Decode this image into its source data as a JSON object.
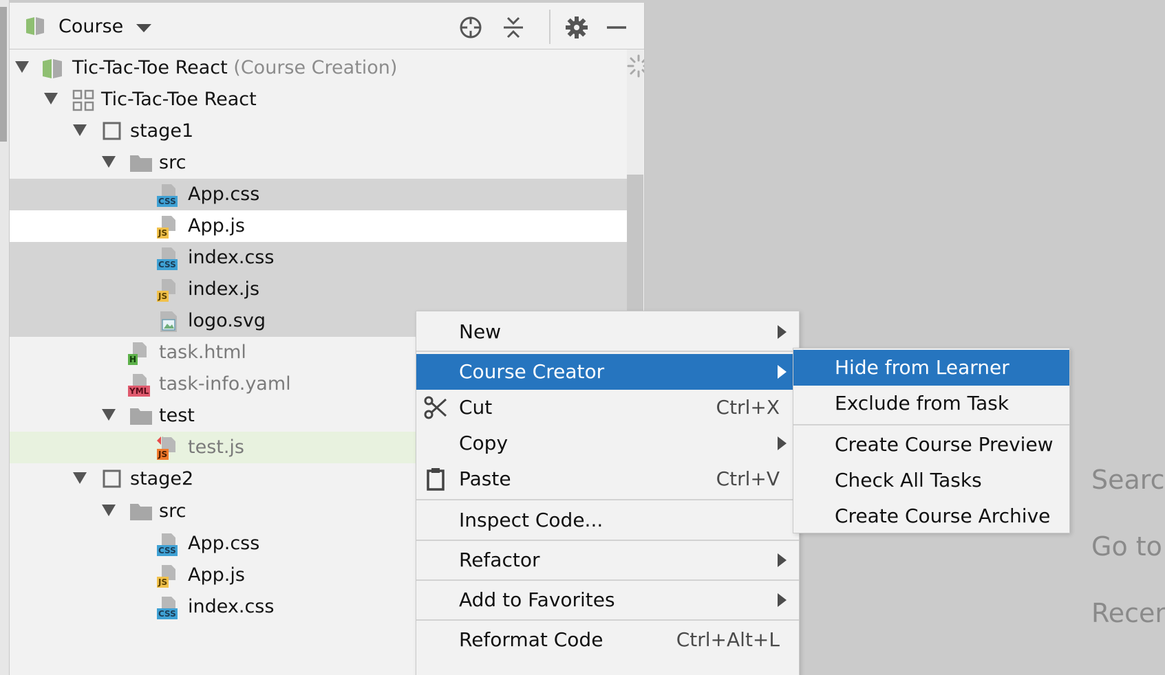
{
  "panel": {
    "view_title": "Course",
    "toolbar_icons": [
      "locate-icon",
      "collapse-all-icon",
      "gear-icon",
      "minimize-icon"
    ]
  },
  "tree": [
    {
      "label": "Tic-Tac-Toe React",
      "suffix": "(Course Creation)",
      "icon": "course-book-icon",
      "expanded": true
    },
    {
      "label": "Tic-Tac-Toe React",
      "icon": "lesson-grid-icon",
      "expanded": true
    },
    {
      "label": "stage1",
      "icon": "task-square-icon",
      "expanded": true
    },
    {
      "label": "src",
      "icon": "folder-icon",
      "expanded": true
    },
    {
      "label": "App.css",
      "icon": "css-file-icon",
      "badge": "CSS",
      "state": "selected"
    },
    {
      "label": "App.js",
      "icon": "js-file-icon",
      "badge": "JS"
    },
    {
      "label": "index.css",
      "icon": "css-file-icon",
      "badge": "CSS",
      "state": "selected"
    },
    {
      "label": "index.js",
      "icon": "js-file-icon",
      "badge": "JS",
      "state": "selected"
    },
    {
      "label": "logo.svg",
      "icon": "image-file-icon",
      "state": "selected"
    },
    {
      "label": "task.html",
      "icon": "html-file-icon",
      "badge": "H",
      "state": "dim"
    },
    {
      "label": "task-info.yaml",
      "icon": "yaml-file-icon",
      "badge": "YML",
      "state": "dim"
    },
    {
      "label": "test",
      "icon": "folder-icon",
      "expanded": true
    },
    {
      "label": "test.js",
      "icon": "test-js-file-icon",
      "badge": "JS",
      "state": "test"
    },
    {
      "label": "stage2",
      "icon": "task-square-icon",
      "expanded": true
    },
    {
      "label": "src",
      "icon": "folder-icon",
      "expanded": true
    },
    {
      "label": "App.css",
      "icon": "css-file-icon",
      "badge": "CSS"
    },
    {
      "label": "App.js",
      "icon": "js-file-icon",
      "badge": "JS"
    },
    {
      "label": "index.css",
      "icon": "css-file-icon",
      "badge": "CSS"
    }
  ],
  "right_hints": [
    "Search",
    "Go to",
    "Recen"
  ],
  "context_menu": {
    "items": [
      {
        "label": "New",
        "submenu": true
      },
      {
        "label": "Course Creator",
        "submenu": true,
        "active": true
      },
      {
        "label": "Cut",
        "shortcut": "Ctrl+X",
        "icon": "scissors-icon"
      },
      {
        "label": "Copy",
        "submenu": true
      },
      {
        "label": "Paste",
        "shortcut": "Ctrl+V",
        "icon": "clipboard-icon"
      },
      {
        "label": "Inspect Code..."
      },
      {
        "label": "Refactor",
        "submenu": true
      },
      {
        "label": "Add to Favorites",
        "submenu": true
      },
      {
        "label": "Reformat Code",
        "shortcut": "Ctrl+Alt+L"
      }
    ]
  },
  "course_creator_submenu": {
    "items": [
      {
        "label": "Hide from Learner",
        "active": true
      },
      {
        "label": "Exclude from Task"
      },
      {
        "label": "Create Course Preview"
      },
      {
        "label": "Check All Tasks"
      },
      {
        "label": "Create Course Archive"
      }
    ]
  },
  "colors": {
    "menu_highlight": "#2675bf",
    "tree_selection": "#d4d4d4",
    "test_row": "#e8f2df",
    "css_badge": "#3fa1d4",
    "js_badge": "#f1c14b",
    "html_badge": "#5db14a",
    "yaml_badge": "#e05a6e",
    "test_js_badge": "#f07a2c"
  }
}
